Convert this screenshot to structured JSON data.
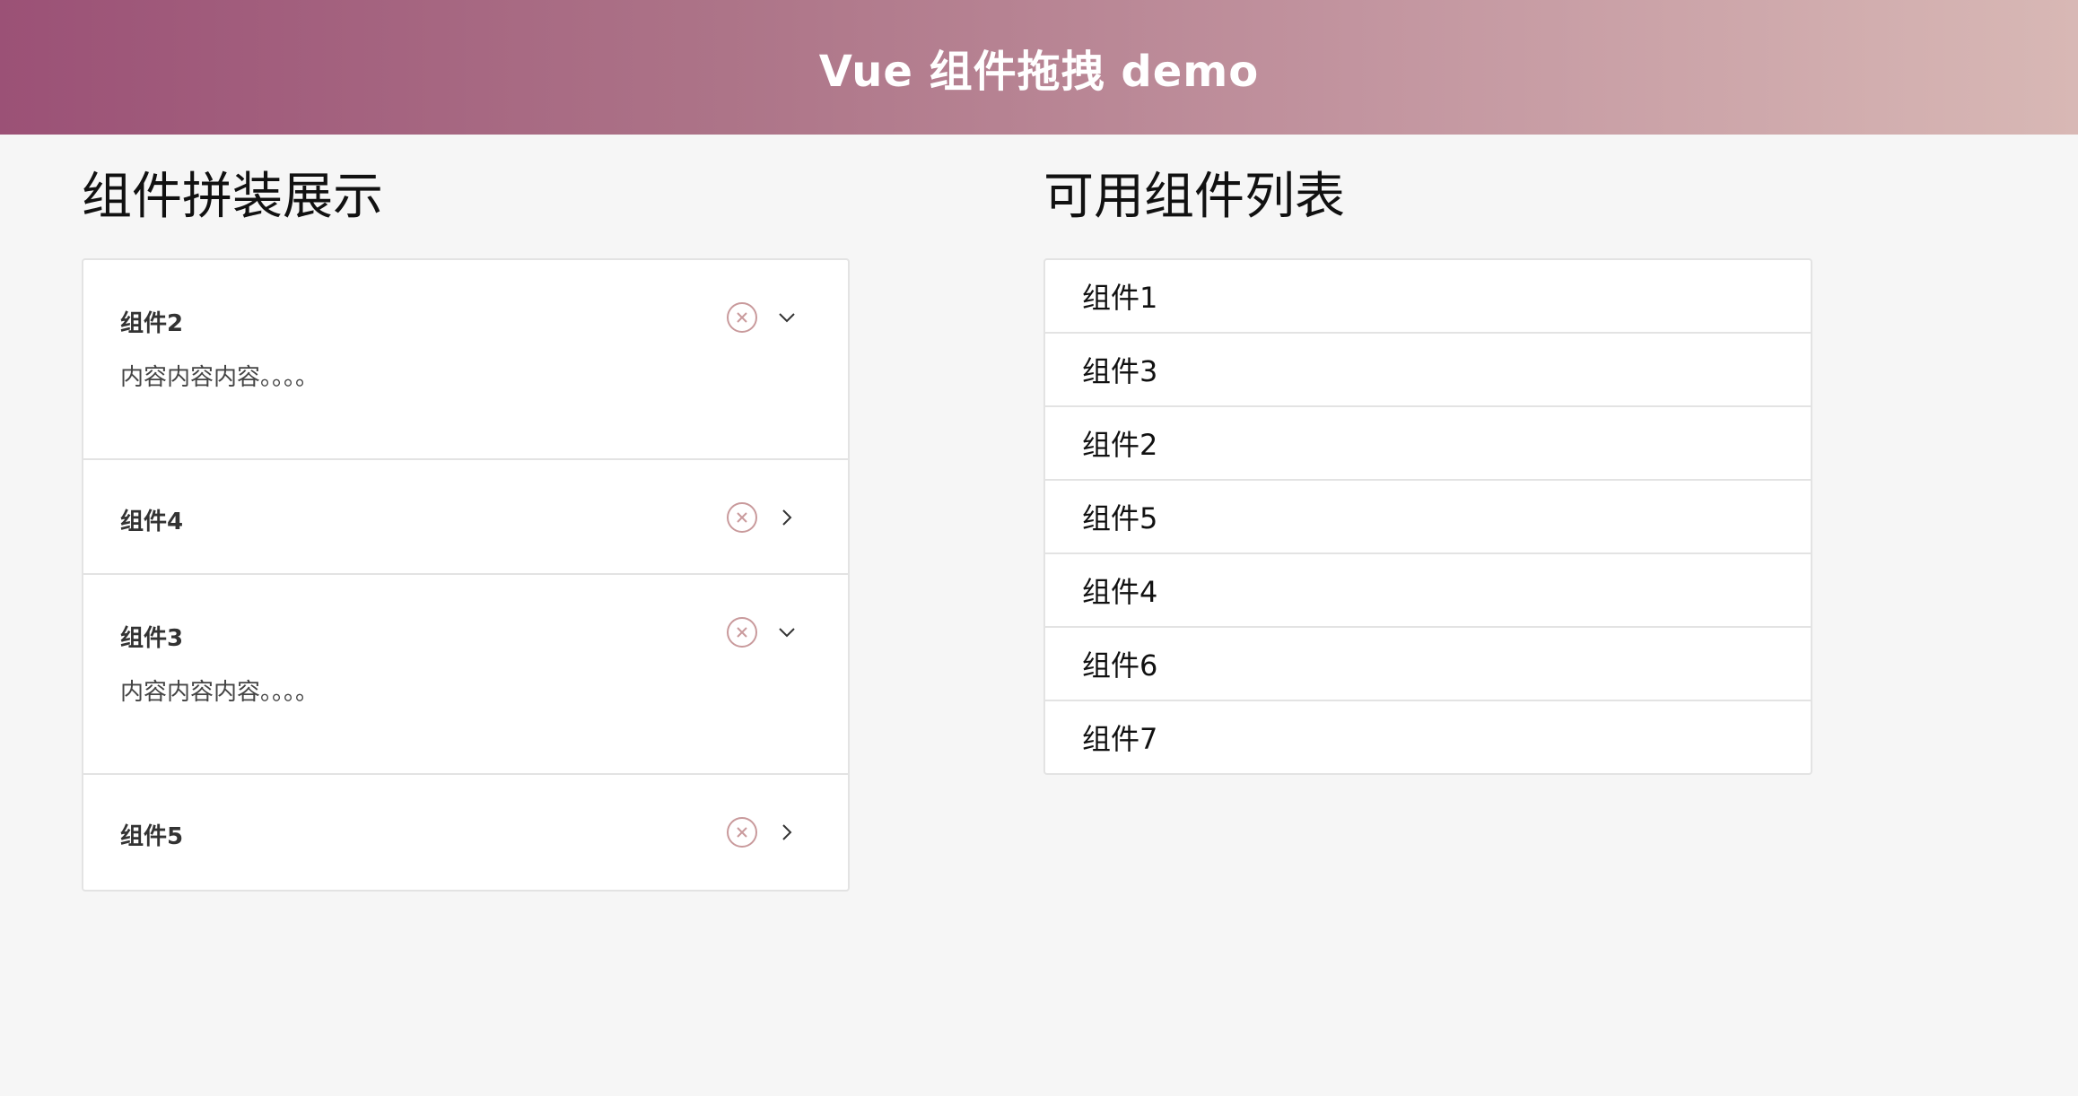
{
  "header": {
    "title": "Vue 组件拖拽 demo"
  },
  "assembly": {
    "title": "组件拼装展示",
    "cards": [
      {
        "name": "组件2",
        "expanded": true,
        "content": "内容内容内容。。。。"
      },
      {
        "name": "组件4",
        "expanded": false,
        "content": ""
      },
      {
        "name": "组件3",
        "expanded": true,
        "content": "内容内容内容。。。。"
      },
      {
        "name": "组件5",
        "expanded": false,
        "content": ""
      }
    ],
    "remove_icon": "close-circle-icon",
    "expand_icon_open": "chevron-down-icon",
    "expand_icon_closed": "chevron-right-icon"
  },
  "available": {
    "title": "可用组件列表",
    "items": [
      "组件1",
      "组件3",
      "组件2",
      "组件5",
      "组件4",
      "组件6",
      "组件7"
    ]
  },
  "colors": {
    "header_gradient_start": "#9b5176",
    "header_gradient_end": "#d8b8b5",
    "icon_color": "#c99a9c",
    "border": "#e3e3e3",
    "background": "#f6f6f6"
  }
}
